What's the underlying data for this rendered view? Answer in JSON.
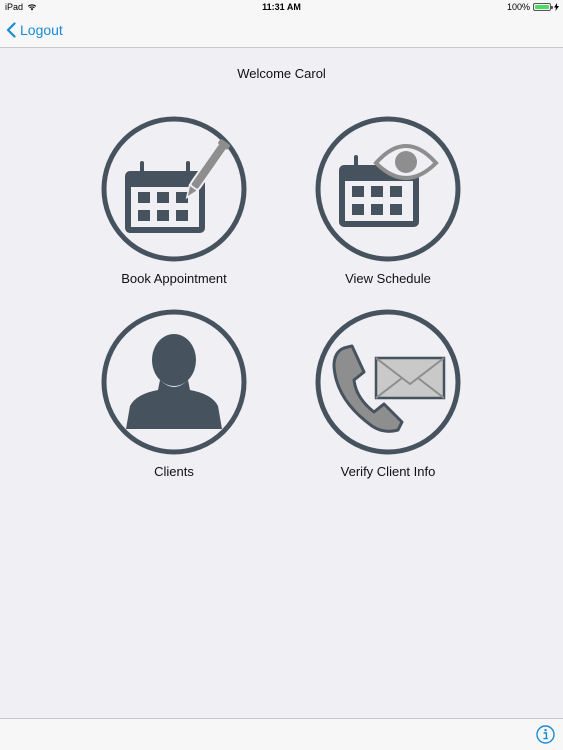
{
  "status_bar": {
    "device": "iPad",
    "time": "11:31 AM",
    "battery": "100%",
    "battery_level": 1.0
  },
  "nav": {
    "back_label": "Logout"
  },
  "welcome_text": "Welcome Carol",
  "tiles": [
    {
      "label": "Book Appointment",
      "icon": "calendar-pen-icon"
    },
    {
      "label": "View Schedule",
      "icon": "calendar-eye-icon"
    },
    {
      "label": "Clients",
      "icon": "person-silhouette-icon"
    },
    {
      "label": "Verify Client Info",
      "icon": "phone-envelope-icon"
    }
  ],
  "toolbar": {
    "info_icon": "info-icon"
  },
  "colors": {
    "accent": "#1a8ad8",
    "icon_dark": "#46535f",
    "icon_grey": "#8e8e8e",
    "background": "#efeff4"
  }
}
